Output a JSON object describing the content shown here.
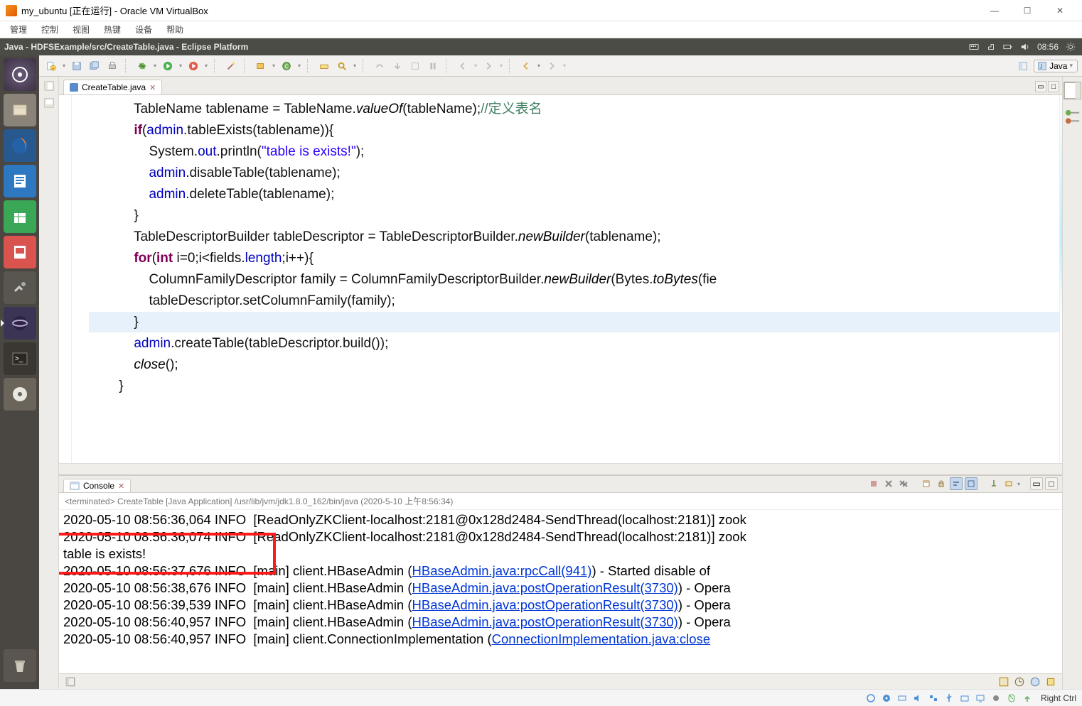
{
  "vbox": {
    "title": "my_ubuntu [正在运行] - Oracle VM VirtualBox",
    "menu": [
      "管理",
      "控制",
      "视图",
      "热键",
      "设备",
      "帮助"
    ],
    "status_right": "Right Ctrl"
  },
  "ubuntu_bar": {
    "title": "Java - HDFSExample/src/CreateTable.java - Eclipse Platform",
    "clock": "08:56"
  },
  "launcher": [
    {
      "name": "dash",
      "label": "Dash"
    },
    {
      "name": "files",
      "label": "Files"
    },
    {
      "name": "firefox",
      "label": "Firefox"
    },
    {
      "name": "writer",
      "label": "Writer"
    },
    {
      "name": "calc",
      "label": "Calc"
    },
    {
      "name": "impress",
      "label": "Impress"
    },
    {
      "name": "settings",
      "label": "Settings"
    },
    {
      "name": "eclipse",
      "label": "Eclipse"
    },
    {
      "name": "terminal",
      "label": "Terminal"
    },
    {
      "name": "disc",
      "label": "Disc"
    }
  ],
  "eclipse": {
    "perspective": "Java",
    "editor_tab": "CreateTable.java",
    "console_tab": "Console",
    "console_status": "<terminated> CreateTable [Java Application] /usr/lib/jvm/jdk1.8.0_162/bin/java (2020-5-10 上午8:56:34)"
  },
  "code": {
    "l1a": "            TableName tablename = TableName.",
    "l1b": "valueOf",
    "l1c": "(tableName);",
    "l1d": "//定义表名",
    "l2a": "            ",
    "l2b": "if",
    "l2c": "(",
    "l2d": "admin",
    "l2e": ".tableExists(tablename)){",
    "l3a": "                System.",
    "l3b": "out",
    "l3c": ".println(",
    "l3d": "\"table is exists!\"",
    "l3e": ");",
    "l4a": "                ",
    "l4b": "admin",
    "l4c": ".disableTable(tablename);",
    "l5a": "                ",
    "l5b": "admin",
    "l5c": ".deleteTable(tablename);",
    "l6": "            }",
    "l7a": "            TableDescriptorBuilder tableDescriptor = TableDescriptorBuilder.",
    "l7b": "newBuilder",
    "l7c": "(tablename);",
    "l8a": "            ",
    "l8b": "for",
    "l8c": "(",
    "l8d": "int",
    "l8e": " i=0;i<fields.",
    "l8f": "length",
    "l8g": ";i++){",
    "l9a": "                ColumnFamilyDescriptor family = ColumnFamilyDescriptorBuilder.",
    "l9b": "newBuilder",
    "l9c": "(Bytes.",
    "l9d": "toBytes",
    "l9e": "(fie",
    "l10": "                tableDescriptor.setColumnFamily(family);",
    "l11": "            }",
    "l12a": "            ",
    "l12b": "admin",
    "l12c": ".createTable(tableDescriptor.build());",
    "l13a": "            ",
    "l13b": "close",
    "l13c": "();",
    "l14": "        }"
  },
  "console": {
    "row1": "2020-05-10 08:56:36,064 INFO  [ReadOnlyZKClient-localhost:2181@0x128d2484-SendThread(localhost:2181)] zook",
    "row2": "2020-05-10 08:56:36,074 INFO  [ReadOnlyZKClient-localhost:2181@0x128d2484-SendThread(localhost:2181)] zook",
    "row3": "table is exists!",
    "row4a": "2020-05-10 08:56:37,676 INFO  [main] client.HBaseAdmin (",
    "row4b": "HBaseAdmin.java:rpcCall(941)",
    "row4c": ") - Started disable of",
    "row5a": "2020-05-10 08:56:38,676 INFO  [main] client.HBaseAdmin (",
    "row5b": "HBaseAdmin.java:postOperationResult(3730)",
    "row5c": ") - Opera",
    "row6a": "2020-05-10 08:56:39,539 INFO  [main] client.HBaseAdmin (",
    "row6b": "HBaseAdmin.java:postOperationResult(3730)",
    "row6c": ") - Opera",
    "row7a": "2020-05-10 08:56:40,957 INFO  [main] client.HBaseAdmin (",
    "row7b": "HBaseAdmin.java:postOperationResult(3730)",
    "row7c": ") - Opera",
    "row8a": "2020-05-10 08:56:40,957 INFO  [main] client.ConnectionImplementation (",
    "row8b": "ConnectionImplementation.java:close"
  }
}
